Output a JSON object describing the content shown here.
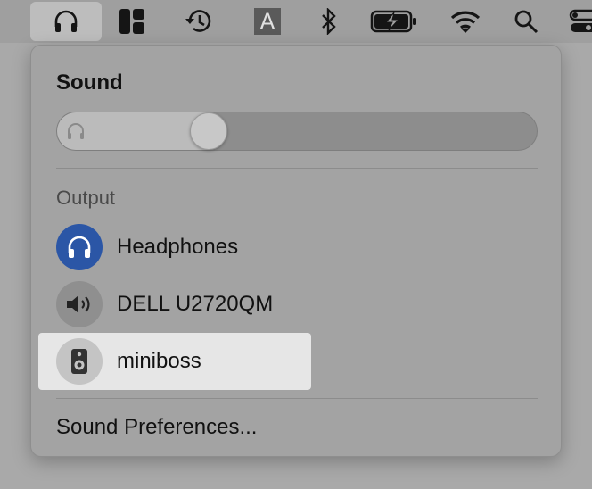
{
  "menubar": {
    "icons": [
      "headphones-icon",
      "dashboard-icon",
      "time-machine-icon",
      "input-source-icon",
      "bluetooth-icon",
      "battery-charging-icon",
      "wifi-icon",
      "search-icon",
      "control-center-icon"
    ],
    "input_source_letter": "A"
  },
  "sound": {
    "title": "Sound",
    "volume_fraction": 0.3,
    "output_label": "Output",
    "devices": [
      {
        "name": "Headphones",
        "icon": "headphones-icon",
        "selected": true
      },
      {
        "name": "DELL U2720QM",
        "icon": "speaker-volume-icon",
        "selected": false
      },
      {
        "name": "miniboss",
        "icon": "speaker-box-icon",
        "selected": false
      }
    ],
    "preferences_label": "Sound Preferences..."
  },
  "colors": {
    "selected_accent": "#2b56a6",
    "panel_bg": "#a3a3a3",
    "hover_bg": "#e6e6e6"
  }
}
